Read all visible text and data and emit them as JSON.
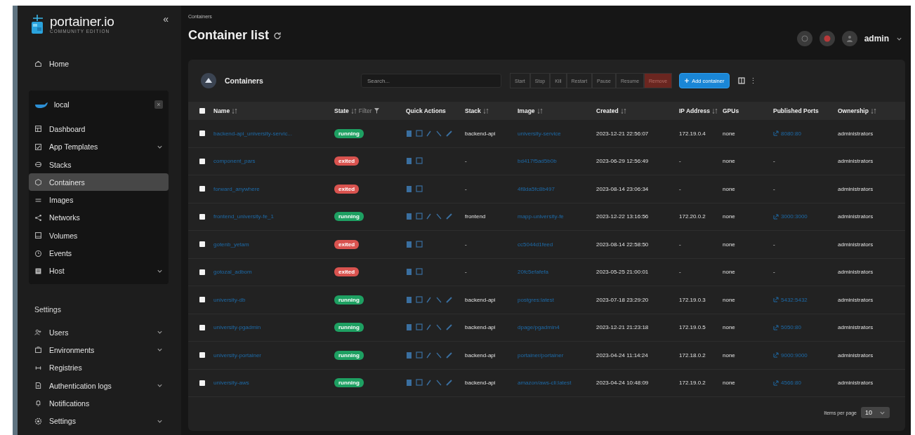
{
  "sidebar": {
    "logo": {
      "name": "portainer.io",
      "edition": "COMMUNITY EDITION"
    },
    "collapse": "«",
    "home": {
      "label": "Home",
      "selected": false
    },
    "environment": {
      "name": "local",
      "close": "×",
      "items": [
        {
          "label": "Dashboard",
          "expandable": false,
          "selected": false
        },
        {
          "label": "App Templates",
          "expandable": true,
          "selected": false
        },
        {
          "label": "Stacks",
          "expandable": false,
          "selected": false
        },
        {
          "label": "Containers",
          "expandable": false,
          "selected": true
        },
        {
          "label": "Images",
          "expandable": false,
          "selected": false
        },
        {
          "label": "Networks",
          "expandable": false,
          "selected": false
        },
        {
          "label": "Volumes",
          "expandable": false,
          "selected": false
        },
        {
          "label": "Events",
          "expandable": false,
          "selected": false
        },
        {
          "label": "Host",
          "expandable": true,
          "selected": false
        }
      ]
    },
    "settings": {
      "title": "Settings",
      "items": [
        {
          "label": "Users",
          "expandable": true,
          "selected": false
        },
        {
          "label": "Environments",
          "expandable": true,
          "selected": false
        },
        {
          "label": "Registries",
          "expandable": false,
          "selected": false
        },
        {
          "label": "Authentication logs",
          "expandable": true,
          "selected": false
        },
        {
          "label": "Notifications",
          "expandable": false,
          "selected": false
        },
        {
          "label": "Settings",
          "expandable": true,
          "selected": false
        }
      ]
    }
  },
  "header": {
    "breadcrumb": "Containers",
    "title": "Container list",
    "user": "admin"
  },
  "card": {
    "title": "Containers",
    "search": {
      "placeholder": "Search..."
    },
    "actions": [
      {
        "label": "Start",
        "kind": "plain",
        "disabled": true
      },
      {
        "label": "Stop",
        "kind": "plain",
        "disabled": true
      },
      {
        "label": "Kill",
        "kind": "plain",
        "disabled": true
      },
      {
        "label": "Restart",
        "kind": "plain",
        "disabled": true
      },
      {
        "label": "Pause",
        "kind": "plain",
        "disabled": true
      },
      {
        "label": "Resume",
        "kind": "plain",
        "disabled": true
      },
      {
        "label": "Remove",
        "kind": "danger",
        "disabled": true
      },
      {
        "label": "Add container",
        "kind": "primary",
        "disabled": false
      }
    ],
    "more": "⋮",
    "table": {
      "select_all": {
        "checked": false
      },
      "columns": [
        {
          "label": "Name",
          "sortable": true
        },
        {
          "label": "State",
          "sortable": true,
          "filter": "Filter"
        },
        {
          "label": "Quick Actions",
          "sortable": false
        },
        {
          "label": "Stack",
          "sortable": true
        },
        {
          "label": "Image",
          "sortable": true
        },
        {
          "label": "Created",
          "sortable": true
        },
        {
          "label": "IP Address",
          "sortable": true
        },
        {
          "label": "GPUs",
          "sortable": false
        },
        {
          "label": "Published Ports",
          "sortable": false
        },
        {
          "label": "Ownership",
          "sortable": true
        }
      ],
      "rows": [
        {
          "checked": false,
          "name": "backend-api_university-servic...",
          "state": {
            "label": "running",
            "kind": "running"
          },
          "stack": "backend-api",
          "image": "university-service",
          "created": "2023-12-21 22:56:07",
          "ip": "172.19.0.4",
          "gpus": "none",
          "ports": {
            "label": "8080:80",
            "kind": "link"
          },
          "ownership": "administrators"
        },
        {
          "checked": false,
          "name": "component_pars",
          "state": {
            "label": "exited",
            "kind": "exited"
          },
          "stack": "-",
          "image": "bd417f5ad5b0b",
          "created": "2023-06-29 12:56:49",
          "ip": "-",
          "gpus": "none",
          "ports": {
            "label": "-",
            "kind": "none"
          },
          "ownership": "administrators"
        },
        {
          "checked": false,
          "name": "forward_anywhere",
          "state": {
            "label": "exited",
            "kind": "exited"
          },
          "stack": "-",
          "image": "4f8da5fc8b497",
          "created": "2023-08-14 23:06:34",
          "ip": "-",
          "gpus": "none",
          "ports": {
            "label": "-",
            "kind": "none"
          },
          "ownership": "administrators"
        },
        {
          "checked": false,
          "name": "frontend_university-fe_1",
          "state": {
            "label": "running",
            "kind": "running"
          },
          "stack": "frontend",
          "image": "mapp-university-fe",
          "created": "2023-12-22 13:16:56",
          "ip": "172.20.0.2",
          "gpus": "none",
          "ports": {
            "label": "3000:3000",
            "kind": "link"
          },
          "ownership": "administrators"
        },
        {
          "checked": false,
          "name": "gotenb_yetam",
          "state": {
            "label": "exited",
            "kind": "exited"
          },
          "stack": "-",
          "image": "cc5044d1feed",
          "created": "2023-08-14 22:58:50",
          "ip": "-",
          "gpus": "none",
          "ports": {
            "label": "-",
            "kind": "none"
          },
          "ownership": "administrators"
        },
        {
          "checked": false,
          "name": "gotozal_adbom",
          "state": {
            "label": "exited",
            "kind": "exited"
          },
          "stack": "-",
          "image": "20fc5efafefa",
          "created": "2023-05-25 21:00:01",
          "ip": "-",
          "gpus": "none",
          "ports": {
            "label": "-",
            "kind": "none"
          },
          "ownership": "administrators"
        },
        {
          "checked": false,
          "name": "university-db",
          "state": {
            "label": "running",
            "kind": "running"
          },
          "stack": "backend-api",
          "image": "postgres:latest",
          "created": "2023-07-18 23:29:20",
          "ip": "172.19.0.3",
          "gpus": "none",
          "ports": {
            "label": "5432:5432",
            "kind": "link"
          },
          "ownership": "administrators"
        },
        {
          "checked": false,
          "name": "university-pgadmin",
          "state": {
            "label": "running",
            "kind": "running"
          },
          "stack": "backend-api",
          "image": "dpage/pgadmin4",
          "created": "2023-12-21 21:23:18",
          "ip": "172.19.0.5",
          "gpus": "none",
          "ports": {
            "label": "5050:80",
            "kind": "link"
          },
          "ownership": "administrators"
        },
        {
          "checked": false,
          "name": "university-portainer",
          "state": {
            "label": "running",
            "kind": "running"
          },
          "stack": "backend-api",
          "image": "portainer/portainer",
          "created": "2023-04-24 11:14:24",
          "ip": "172.18.0.2",
          "gpus": "none",
          "ports": {
            "label": "9000:9000",
            "kind": "link"
          },
          "ownership": "administrators"
        },
        {
          "checked": false,
          "name": "university-aws",
          "state": {
            "label": "running",
            "kind": "running"
          },
          "stack": "backend-api",
          "image": "amazon/aws-cli:latest",
          "created": "2023-04-24 10:48:09",
          "ip": "172.19.0.2",
          "gpus": "none",
          "ports": {
            "label": "4566:80",
            "kind": "link"
          },
          "ownership": "administrators"
        }
      ]
    },
    "pagination": {
      "label": "Items per page",
      "value": "10"
    }
  }
}
